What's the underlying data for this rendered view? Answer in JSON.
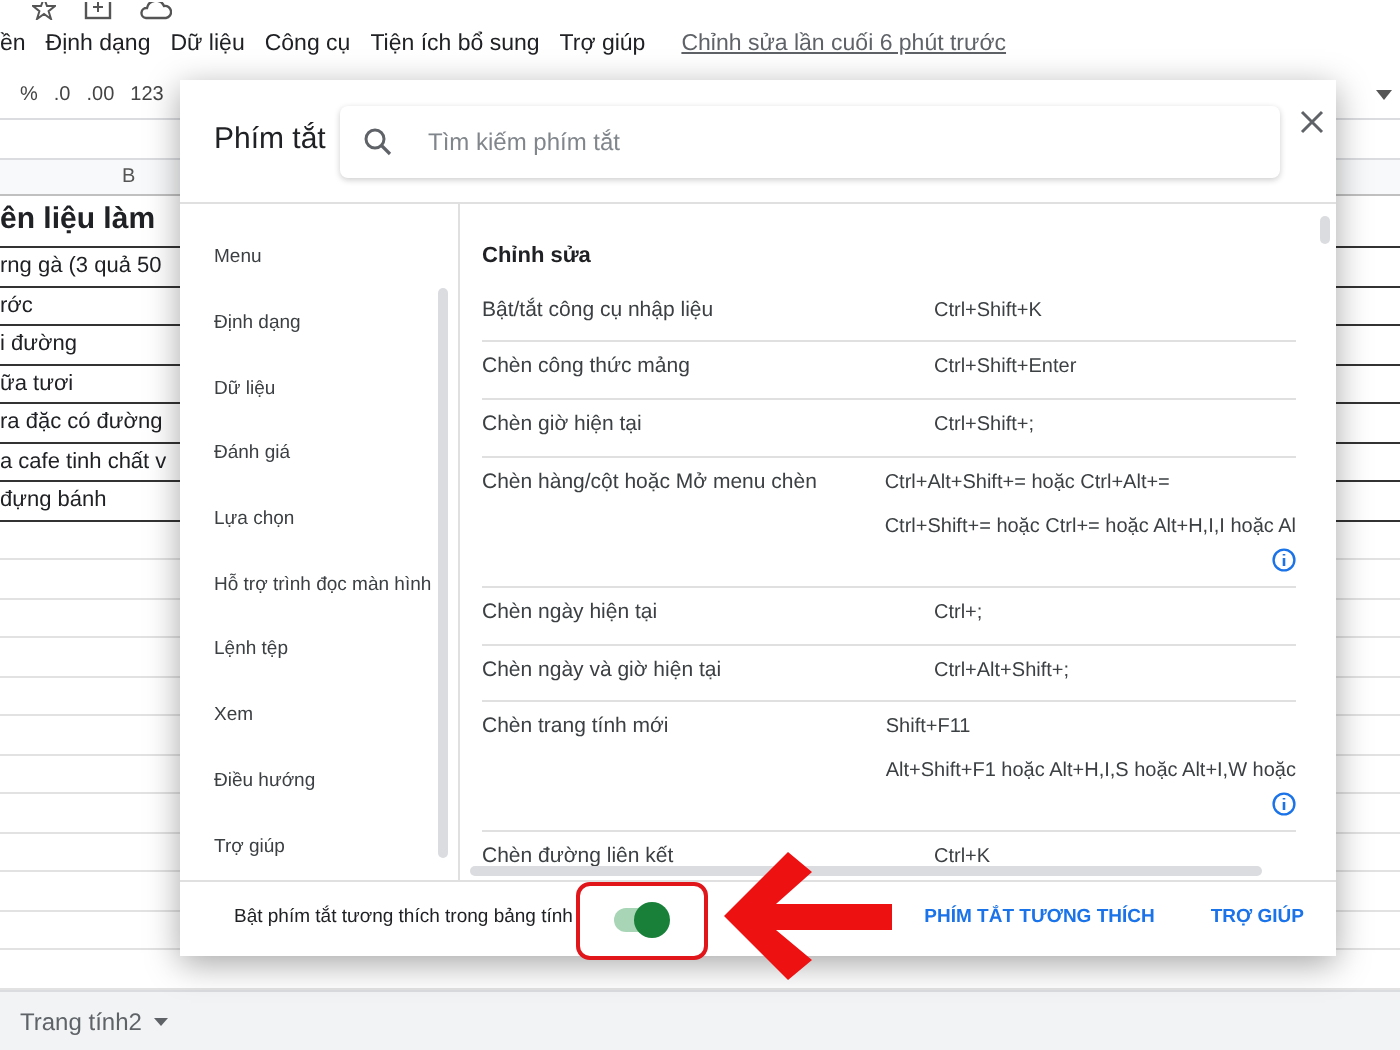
{
  "menu_bar": {
    "items": [
      "ền",
      "Định dạng",
      "Dữ liệu",
      "Công cụ",
      "Tiện ích bổ sung",
      "Trợ giúp"
    ],
    "last_edit": "Chỉnh sửa lần cuối 6 phút trước"
  },
  "toolbar": {
    "items": [
      "%",
      ".0",
      ".00",
      "123"
    ]
  },
  "sheet": {
    "column_header": "B",
    "rows": [
      {
        "text": "ên liệu làm",
        "bold": true
      },
      {
        "text": "rng gà (3 quả 50",
        "bold": false
      },
      {
        "text": "rớc",
        "bold": false
      },
      {
        "text": "i đường",
        "bold": false
      },
      {
        "text": "ữa tươi",
        "bold": false
      },
      {
        "text": "ra đặc có đường",
        "bold": false
      },
      {
        "text": "a cafe tinh chất v",
        "bold": false
      },
      {
        "text": "đựng bánh",
        "bold": false
      }
    ],
    "tab": "Trang tính2"
  },
  "dialog": {
    "title": "Phím tắt",
    "search": {
      "placeholder": "Tìm kiếm phím tắt"
    },
    "categories": [
      {
        "label": "Menu",
        "selected": false
      },
      {
        "label": "Định dạng",
        "selected": false
      },
      {
        "label": "Dữ liệu",
        "selected": false
      },
      {
        "label": "Đánh giá",
        "selected": false
      },
      {
        "label": "Lựa chọn",
        "selected": false
      },
      {
        "label": "Hỗ trợ trình đọc màn hình",
        "selected": false
      },
      {
        "label": "Lệnh tệp",
        "selected": false
      },
      {
        "label": "Xem",
        "selected": false
      },
      {
        "label": "Điều hướng",
        "selected": false
      },
      {
        "label": "Trợ giúp",
        "selected": false
      }
    ],
    "section_title": "Chỉnh sửa",
    "shortcuts": [
      {
        "action": "Bật/tắt công cụ nhập liệu",
        "keys": [
          "Ctrl+Shift+K"
        ],
        "info": false
      },
      {
        "action": "Chèn công thức mảng",
        "keys": [
          "Ctrl+Shift+Enter"
        ],
        "info": false
      },
      {
        "action": "Chèn giờ hiện tại",
        "keys": [
          "Ctrl+Shift+;"
        ],
        "info": false
      },
      {
        "action": "Chèn hàng/cột hoặc Mở menu chèn",
        "keys": [
          "Ctrl+Alt+Shift+= hoặc Ctrl+Alt+=",
          "Ctrl+Shift+= hoặc Ctrl+= hoặc Alt+H,I,I hoặc Al"
        ],
        "info": true
      },
      {
        "action": "Chèn ngày hiện tại",
        "keys": [
          "Ctrl+;"
        ],
        "info": false
      },
      {
        "action": "Chèn ngày và giờ hiện tại",
        "keys": [
          "Ctrl+Alt+Shift+;"
        ],
        "info": false
      },
      {
        "action": "Chèn trang tính mới",
        "keys": [
          "Shift+F11",
          "Alt+Shift+F1 hoặc Alt+H,I,S hoặc Alt+I,W hoặc"
        ],
        "info": true
      },
      {
        "action": "Chèn đường liên kết",
        "keys": [
          "Ctrl+K"
        ],
        "info": false
      }
    ],
    "footer": {
      "toggle_label": "Bật phím tắt tương thích trong bảng tính",
      "toggle_on": true,
      "buttons": [
        "PHÍM TẮT TƯƠNG THÍCH",
        "TRỢ GIÚP"
      ]
    }
  }
}
